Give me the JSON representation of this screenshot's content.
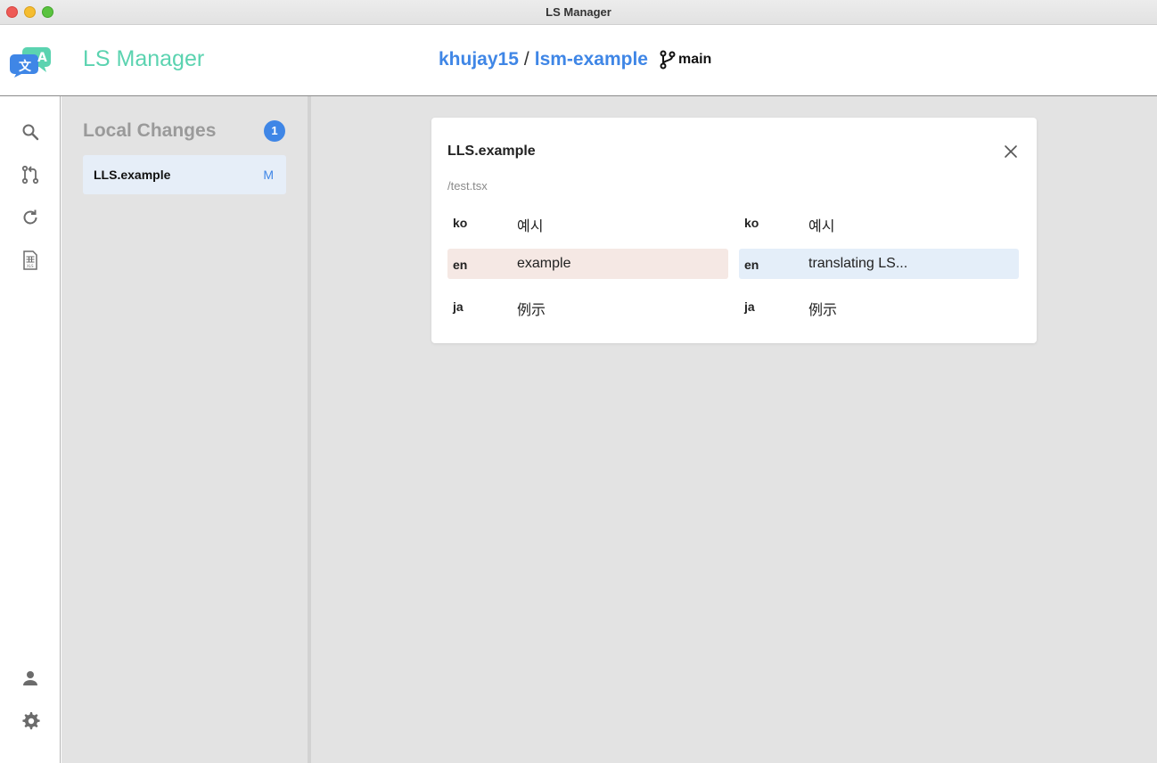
{
  "window": {
    "title": "LS Manager"
  },
  "header": {
    "app_name": "LS Manager",
    "owner": "khujay15",
    "separator": "/",
    "repo": "lsm-example",
    "branch": "main"
  },
  "rail": {
    "top_icons": [
      "search-icon",
      "pull-request-icon",
      "refresh-icon",
      "spreadsheet-icon"
    ],
    "bottom_icons": [
      "user-icon",
      "gear-icon"
    ]
  },
  "changes_panel": {
    "title": "Local Changes",
    "count": "1",
    "items": [
      {
        "name": "LLS.example",
        "status": "M"
      }
    ]
  },
  "diff": {
    "key": "LLS.example",
    "path": "/test.tsx",
    "before": [
      {
        "lang": "ko",
        "value": "예시"
      },
      {
        "lang": "en",
        "value": "example"
      },
      {
        "lang": "ja",
        "value": "例示"
      }
    ],
    "after": [
      {
        "lang": "ko",
        "value": "예시"
      },
      {
        "lang": "en",
        "value": "translating LS..."
      },
      {
        "lang": "ja",
        "value": "例示"
      }
    ]
  },
  "colors": {
    "accent": "#3f86e6",
    "app_name": "#5bd3b0",
    "removed_bg": "#f5e8e4",
    "added_bg": "#e4eef9"
  }
}
